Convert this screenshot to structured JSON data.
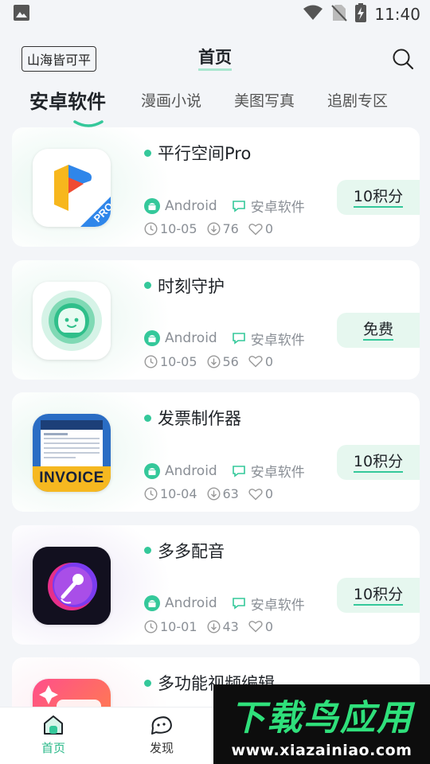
{
  "status_bar": {
    "time": "11:40",
    "icons": [
      "image-icon",
      "wifi-icon",
      "no-sim-icon",
      "battery-charging-icon"
    ]
  },
  "header": {
    "site_tag": "山海皆可平",
    "title": "首页",
    "search_icon": "search-icon"
  },
  "tabs": [
    {
      "label": "安卓软件",
      "active": true
    },
    {
      "label": "漫画小说",
      "active": false
    },
    {
      "label": "美图写真",
      "active": false
    },
    {
      "label": "追剧专区",
      "active": false
    }
  ],
  "apps": [
    {
      "name": "平行空间Pro",
      "platform": "Android",
      "category": "安卓软件",
      "date": "10-05",
      "downloads": "76",
      "likes": "0",
      "price": "10积分",
      "icon": "parallel-space-pro-icon"
    },
    {
      "name": "时刻守护",
      "platform": "Android",
      "category": "安卓软件",
      "date": "10-05",
      "downloads": "56",
      "likes": "0",
      "price": "免费",
      "icon": "guardian-icon"
    },
    {
      "name": "发票制作器",
      "platform": "Android",
      "category": "安卓软件",
      "date": "10-04",
      "downloads": "63",
      "likes": "0",
      "price": "10积分",
      "icon": "invoice-maker-icon",
      "icon_text": "INVOICE"
    },
    {
      "name": "多多配音",
      "platform": "Android",
      "category": "安卓软件",
      "date": "10-01",
      "downloads": "43",
      "likes": "0",
      "price": "10积分",
      "icon": "dubbing-mic-icon"
    },
    {
      "name": "多功能视频编辑",
      "icon": "video-editor-icon"
    }
  ],
  "bottom_nav": [
    {
      "label": "首页",
      "icon": "home-icon",
      "active": true
    },
    {
      "label": "发现",
      "icon": "discover-icon",
      "active": false
    }
  ],
  "watermark": {
    "title": "下载鸟应用",
    "url": "www.xiazainiao.com"
  },
  "colors": {
    "accent": "#34c89a",
    "price_bg": "#e6f7ef",
    "background": "#f3f5f8"
  }
}
